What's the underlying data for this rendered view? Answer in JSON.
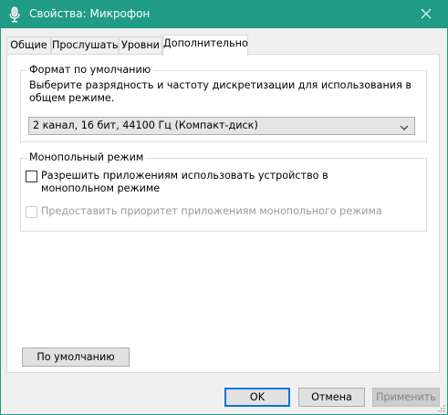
{
  "window": {
    "title": "Свойства: Микрофон",
    "accent_color": "#1f9b86"
  },
  "tabs": [
    {
      "label": "Общие",
      "active": false
    },
    {
      "label": "Прослушать",
      "active": false
    },
    {
      "label": "Уровни",
      "active": false
    },
    {
      "label": "Дополнительно",
      "active": true
    }
  ],
  "default_format": {
    "legend": "Формат по умолчанию",
    "description": "Выберите разрядность и частоту дискретизации для использования в общем режиме.",
    "selected_value": "2 канал, 16 бит, 44100 Гц (Компакт-диск)"
  },
  "exclusive_mode": {
    "legend": "Монопольный режим",
    "allow_exclusive": {
      "label": "Разрешить приложениям использовать устройство в монопольном режиме",
      "checked": false,
      "enabled": true
    },
    "give_priority": {
      "label": "Предоставить приоритет приложениям монопольного режима",
      "checked": false,
      "enabled": false
    }
  },
  "buttons": {
    "restore_defaults": "По умолчанию",
    "ok": "OK",
    "cancel": "Отмена",
    "apply": "Применить"
  },
  "icons": {
    "title": "microphone-icon",
    "close": "close-icon",
    "dropdown": "chevron-down-icon",
    "resize": "resize-grip-icon"
  }
}
